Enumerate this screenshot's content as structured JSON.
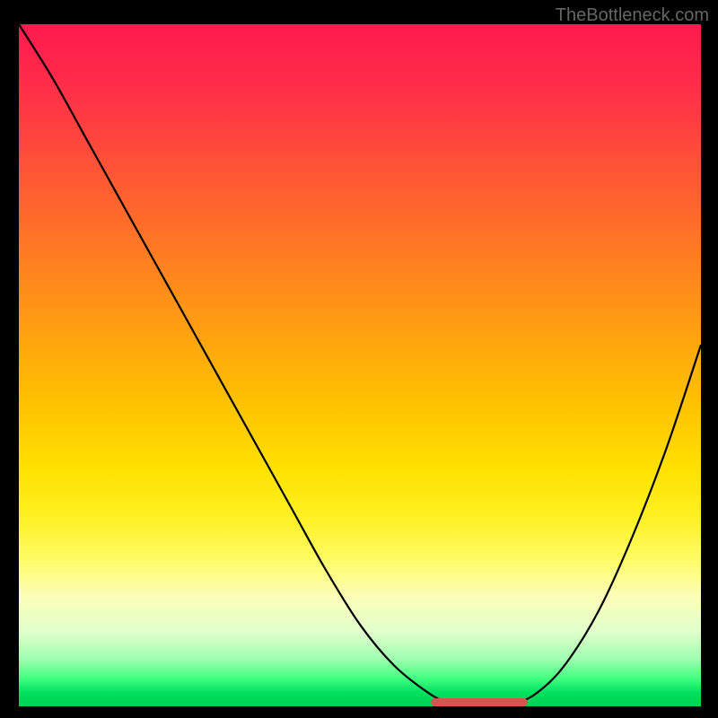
{
  "watermark": "TheBottleneck.com",
  "chart_data": {
    "type": "line",
    "title": "",
    "xlabel": "",
    "ylabel": "",
    "xlim": [
      0,
      100
    ],
    "ylim": [
      0,
      100
    ],
    "grid": false,
    "background_gradient": {
      "top": "#ff1a4d",
      "middle": "#ffe000",
      "bottom": "#00d050"
    },
    "series": [
      {
        "name": "bottleneck-curve",
        "color": "#000000",
        "x": [
          0,
          5,
          10,
          15,
          20,
          25,
          30,
          35,
          40,
          45,
          50,
          55,
          60,
          63,
          66,
          70,
          73,
          76,
          80,
          85,
          90,
          95,
          100
        ],
        "y": [
          100,
          92,
          83,
          74,
          65,
          56,
          47,
          38,
          29,
          20,
          12,
          6,
          2,
          0.5,
          0,
          0,
          0.5,
          2,
          6,
          14,
          25,
          38,
          53
        ]
      }
    ],
    "annotations": [
      {
        "name": "optimal-flat-zone",
        "color": "#d9534f",
        "x_start": 61,
        "x_end": 74,
        "y": 0.6
      }
    ]
  }
}
